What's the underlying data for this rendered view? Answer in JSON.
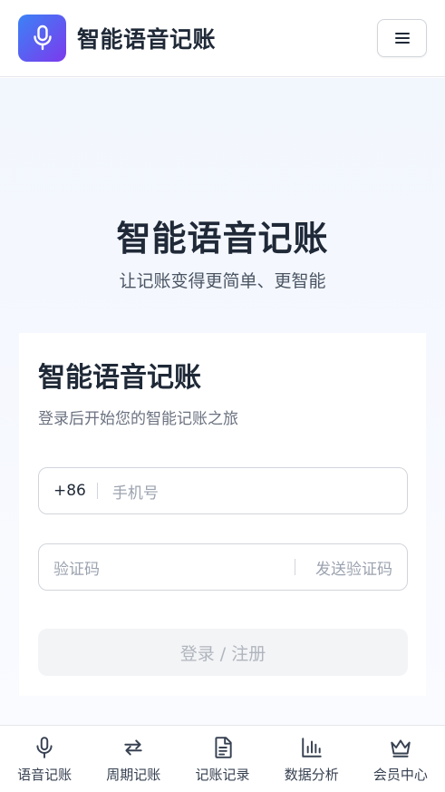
{
  "header": {
    "app_title": "智能语音记账",
    "logo_icon": "microphone-icon",
    "menu_icon": "hamburger-menu-icon"
  },
  "hero": {
    "title": "智能语音记账",
    "subtitle": "让记账变得更简单、更智能"
  },
  "login_card": {
    "title": "智能语音记账",
    "subtitle": "登录后开始您的智能记账之旅",
    "phone": {
      "prefix": "+86",
      "placeholder": "手机号",
      "value": ""
    },
    "code": {
      "placeholder": "验证码",
      "value": "",
      "send_label": "发送验证码"
    },
    "submit_label": "登录 / 注册"
  },
  "tabbar": {
    "items": [
      {
        "label": "语音记账",
        "icon": "microphone-icon"
      },
      {
        "label": "周期记账",
        "icon": "repeat-icon"
      },
      {
        "label": "记账记录",
        "icon": "document-icon"
      },
      {
        "label": "数据分析",
        "icon": "bar-chart-icon"
      },
      {
        "label": "会员中心",
        "icon": "crown-icon"
      }
    ]
  },
  "colors": {
    "brand_gradient_start": "#3b82f6",
    "brand_gradient_end": "#7c3aed",
    "text_primary": "#1f2937",
    "text_muted": "#9ca3af",
    "border": "#d1d5db"
  }
}
